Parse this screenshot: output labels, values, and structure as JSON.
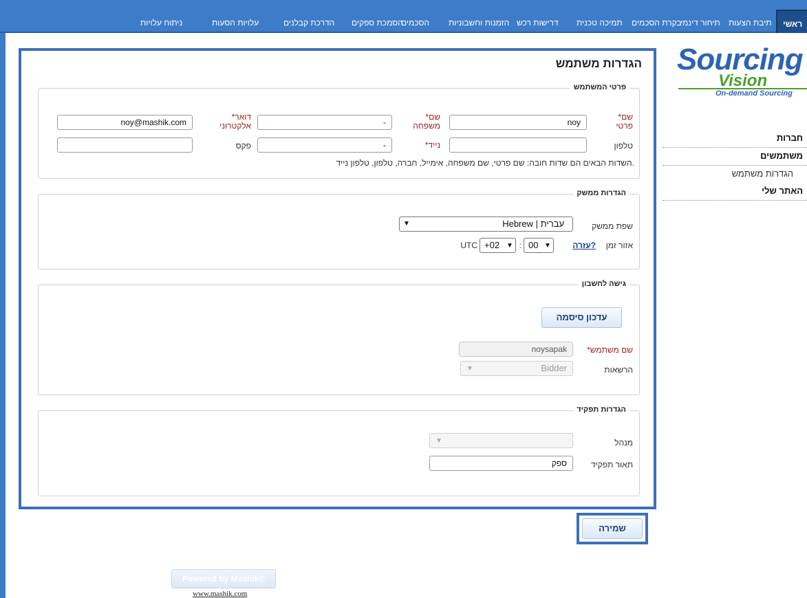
{
  "nav": {
    "items": [
      "ראשי",
      "תיבת הצעות",
      "תיחור דינמי",
      "בקרת הסכמים",
      "תמיכה טכנית",
      "דרישות רכש",
      "הזמנות וחשבוניות",
      "הסכמים",
      "הסמכת ספקים",
      "הדרכת קבלנים",
      "עלויות הסעות",
      "ניתוח עלויות"
    ],
    "active": "ראשי"
  },
  "logo": {
    "main": "Sourcing",
    "sub": "Vision",
    "tagline": "On-demand Sourcing"
  },
  "sidebar": {
    "items": [
      "חברות",
      "משתמשים",
      "הגדרות משתמש",
      "האתר שלי"
    ]
  },
  "page": {
    "title": "הגדרות משתמש"
  },
  "user_details": {
    "legend": "פרטי המשתמש",
    "first_name": {
      "label_top": "*שם",
      "label_bottom": "פרטי",
      "value": "noy"
    },
    "last_name": {
      "label_top": "*שם",
      "label_bottom": "משפחה",
      "value": "-"
    },
    "email": {
      "label_top": "*דואר",
      "label_bottom": "אלקטרוני",
      "value": "noy@mashik.com"
    },
    "phone": {
      "label": "טלפון",
      "value": ""
    },
    "mobile": {
      "label": "*נייד",
      "value": "-"
    },
    "fax": {
      "label": "פקס",
      "value": ""
    },
    "note": "השדות הבאים הם שדות חובה: שם פרטי, שם משפחה, אימייל, חברה, טלפון, טלפון נייד."
  },
  "interface": {
    "legend": "הגדרות ממשק",
    "language_label": "שפת ממשק",
    "language_value": "Hebrew | עברית",
    "timezone_label": "אזור זמן",
    "help_link": "עזרה?",
    "tz_minutes": "00",
    "tz_separator": ":",
    "tz_hours": "+02",
    "tz_suffix": "UTC"
  },
  "account": {
    "legend": "גישה לחשבון",
    "update_password_button": "עדכון סיסמה",
    "username_label": "*שם משתמש",
    "username_value": "noysapak",
    "permissions_label": "הרשאות",
    "permissions_value": "Bidder"
  },
  "role": {
    "legend": "הגדרות תפקיד",
    "manager_label": "מנהל",
    "manager_value": "",
    "role_desc_label": "תאור תפקיד",
    "role_desc_value": "ספק"
  },
  "actions": {
    "save": "שמירה"
  },
  "footer": {
    "badge": "Powered by Mashik®",
    "link": "www.mashik.com"
  }
}
